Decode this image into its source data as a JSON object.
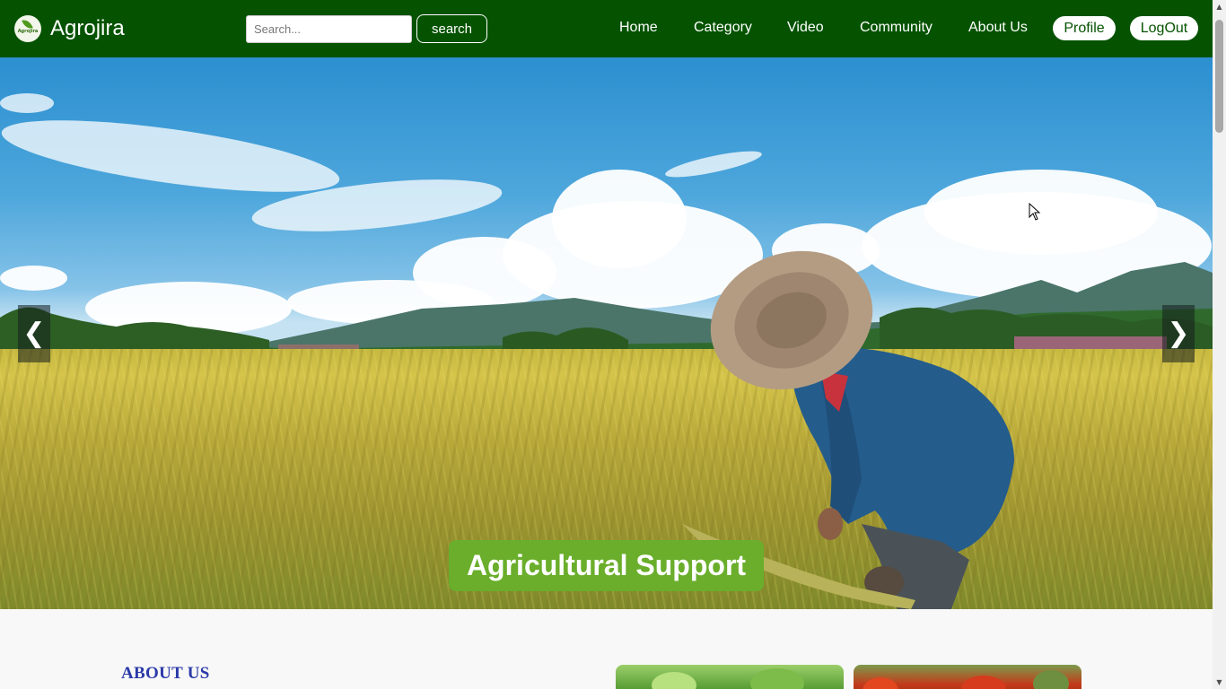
{
  "header": {
    "brand": "Agrojira",
    "logo_text": "Agrojira",
    "search": {
      "placeholder": "Search...",
      "button_label": "search"
    },
    "nav": [
      "Home",
      "Category",
      "Video",
      "Community",
      "About Us"
    ],
    "profile_label": "Profile",
    "logout_label": "LogOut"
  },
  "hero": {
    "caption": "Agricultural Support",
    "prev_label": "❮",
    "next_label": "❯"
  },
  "about": {
    "title": "ABOUT US"
  },
  "colors": {
    "navbar": "#055300",
    "caption_bg": "#6aae2b",
    "section_title": "#2b3aa8",
    "page_bg": "#f8f8f8"
  },
  "icons": [
    "logo-icon",
    "chevron-left-icon",
    "chevron-right-icon",
    "mouse-cursor-icon"
  ]
}
